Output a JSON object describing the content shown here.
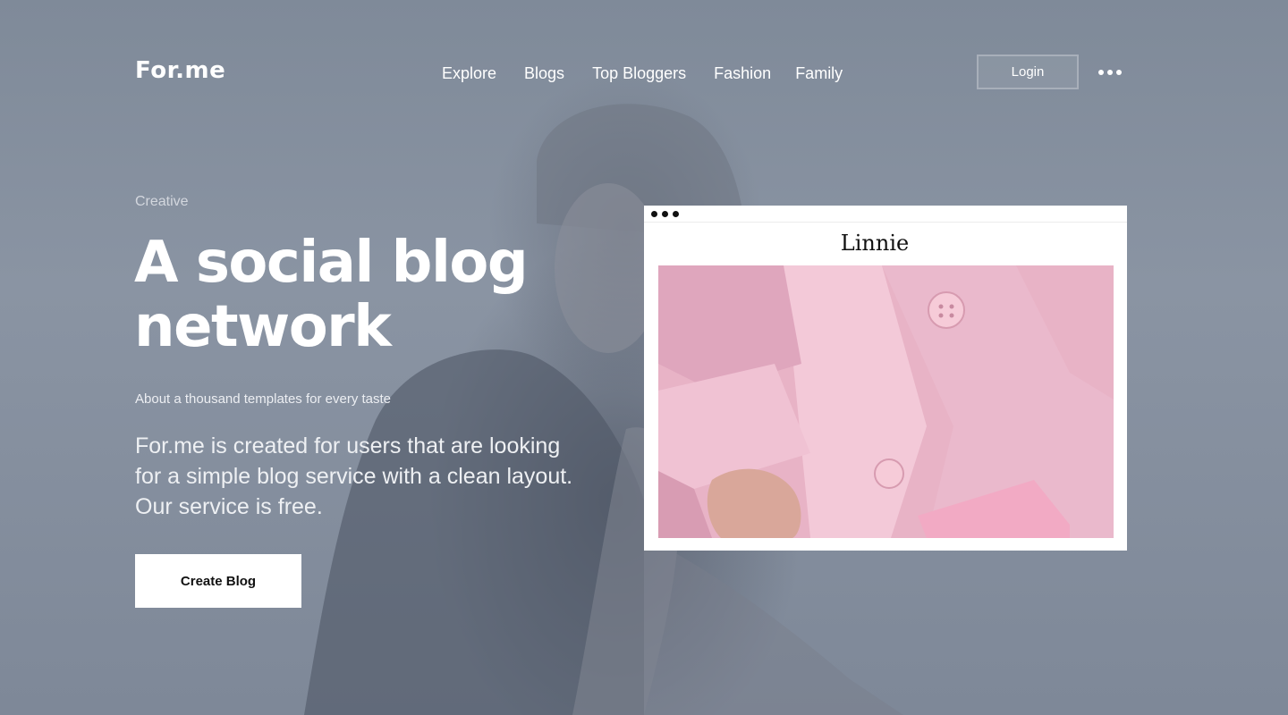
{
  "header": {
    "logo": "For.me",
    "nav": [
      "Explore",
      "Blogs",
      "Top Bloggers",
      "Fashion",
      "Family"
    ],
    "login_label": "Login",
    "more_icon": "more-horizontal-icon"
  },
  "hero": {
    "eyebrow": "Creative",
    "headline_line1": "A social blog",
    "headline_line2": "network",
    "subhead": "About a thousand templates for every taste",
    "description_line1": "For.me is created for users that are looking",
    "description_line2": "for a simple blog service with a clean layout.",
    "description_line3": "Our service is free.",
    "cta_label": "Create Blog"
  },
  "preview": {
    "title": "Linnie",
    "image": "pink-blazer-photo"
  },
  "colors": {
    "background": "#7f8999",
    "text": "#ffffff",
    "button_bg": "#ffffff",
    "button_text": "#111111",
    "preview_accent": "#e9b6c9"
  }
}
